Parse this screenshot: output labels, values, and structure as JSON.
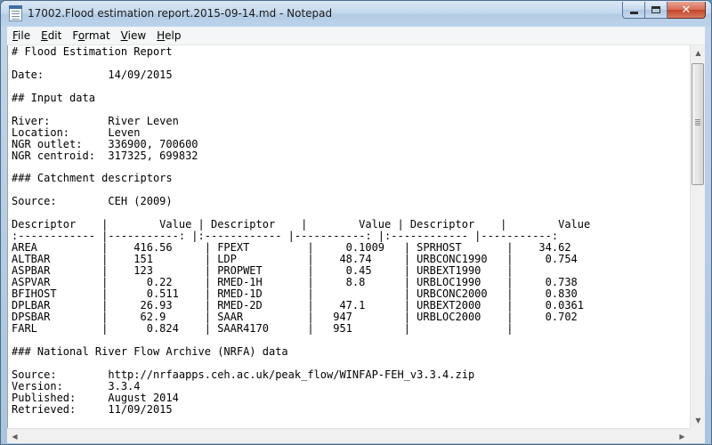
{
  "window": {
    "title": "17002.Flood estimation report.2015-09-14.md - Notepad"
  },
  "menu": [
    {
      "accel": "F",
      "rest": "ile"
    },
    {
      "accel": "E",
      "rest": "dit"
    },
    {
      "pre": "F",
      "accel": "o",
      "rest": "rmat"
    },
    {
      "accel": "V",
      "rest": "iew"
    },
    {
      "accel": "H",
      "rest": "elp"
    }
  ],
  "document": {
    "lines": [
      "# Flood Estimation Report",
      "",
      "Date:          14/09/2015",
      "",
      "## Input data",
      "",
      "River:         River Leven",
      "Location:      Leven",
      "NGR outlet:    336900, 700600",
      "NGR centroid:  317325, 699832",
      "",
      "### Catchment descriptors",
      "",
      "Source:        CEH (2009)",
      "",
      "Descriptor    |        Value | Descriptor    |        Value | Descriptor    |        Value",
      ":------------ |-----------: |:------------ |-----------: |:------------ |-----------:",
      "AREA          |    416.56     | FPEXT         |     0.1009   | SPRHOST       |    34.62",
      "ALTBAR        |    151        | LDP           |    48.74     | URBCONC1990   |     0.754",
      "ASPBAR        |    123        | PROPWET       |     0.45     | URBEXT1990    |",
      "ASPVAR        |      0.22     | RMED-1H       |     8.8      | URBLOC1990    |     0.738",
      "BFIHOST       |      0.511    | RMED-1D       |              | URBCONC2000   |     0.830",
      "DPLBAR        |     26.93     | RMED-2D       |    47.1      | URBEXT2000    |     0.0361",
      "DPSBAR        |     62.9      | SAAR          |   947        | URBLOC2000    |     0.702",
      "FARL          |      0.824    | SAAR4170      |   951        |               |",
      "",
      "### National River Flow Archive (NRFA) data",
      "",
      "Source:        http://nrfaapps.ceh.ac.uk/peak_flow/WINFAP-FEH_v3.3.4.zip",
      "Version:       3.3.4",
      "Published:     August 2014",
      "Retrieved:     11/09/2015"
    ]
  }
}
